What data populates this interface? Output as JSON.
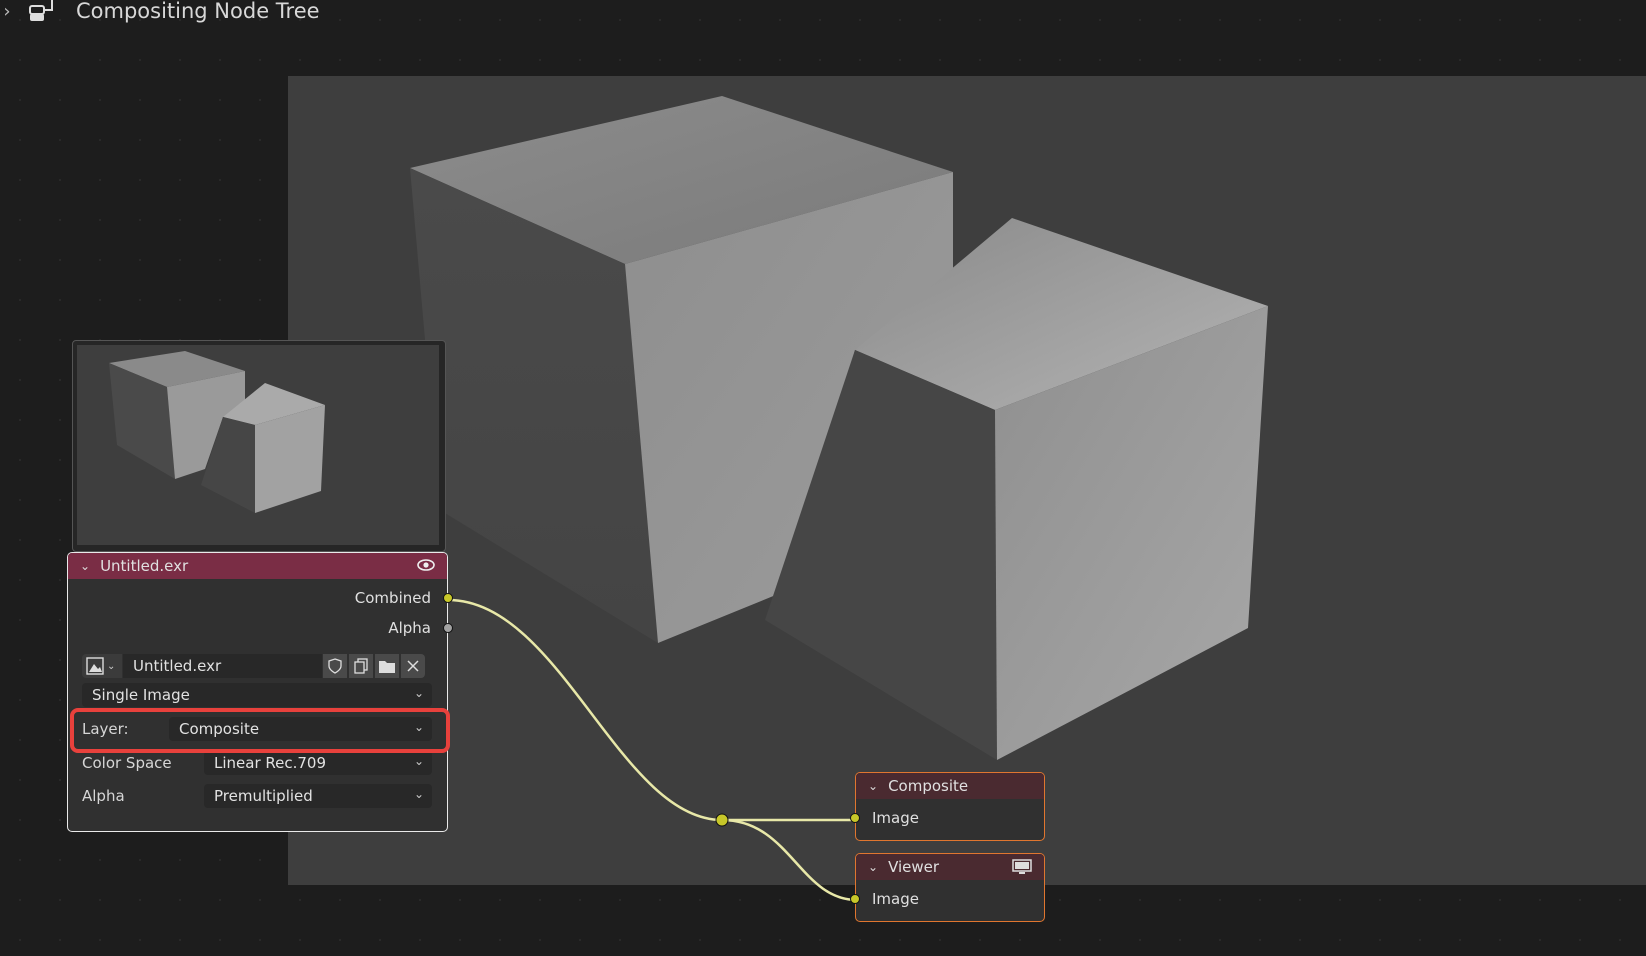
{
  "breadcrumb": {
    "title": "Compositing Node Tree",
    "expand_icon": "chevron-right-icon",
    "tree_icon": "node-tree-icon"
  },
  "image_node": {
    "name": "Untitled.exr",
    "header_color": "#7a2d45",
    "visibility_icon": "eye-icon",
    "outputs": [
      "Combined",
      "Alpha"
    ],
    "image_field": "Untitled.exr",
    "source": "Single Image",
    "layer_label": "Layer:",
    "layer_value": "Composite",
    "color_space_label": "Color Space",
    "color_space_value": "Linear Rec.709",
    "alpha_label": "Alpha",
    "alpha_value": "Premultiplied",
    "field_icons": [
      "image-browse-icon",
      "fake-user-shield-icon",
      "duplicate-icon",
      "open-folder-icon",
      "close-icon"
    ]
  },
  "composite_node": {
    "name": "Composite",
    "header_color": "#4a2a30",
    "input": "Image"
  },
  "viewer_node": {
    "name": "Viewer",
    "header_color": "#4a2a30",
    "input": "Image",
    "header_icon": "monitor-icon"
  },
  "colors": {
    "link": "#e8e8a8",
    "socket_color": "#c7c729",
    "output_node_border": "#e0762f",
    "highlight": "#e8413c"
  }
}
